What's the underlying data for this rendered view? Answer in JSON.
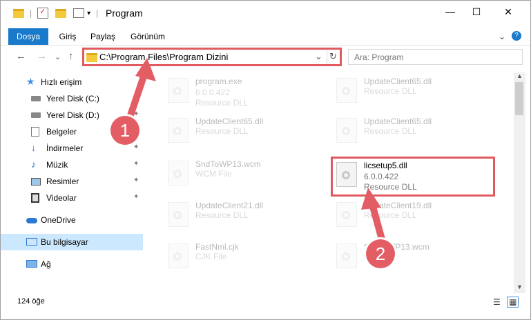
{
  "window": {
    "title": "Program",
    "minimize_glyph": "—",
    "maximize_glyph": "☐",
    "close_glyph": "✕"
  },
  "ribbon": {
    "tabs": [
      "Dosya",
      "Giriş",
      "Paylaş",
      "Görünüm"
    ],
    "expand_glyph": "⌄",
    "help_glyph": "?"
  },
  "nav": {
    "back_glyph": "←",
    "forward_glyph": "→",
    "recent_glyph": "⌄",
    "up_glyph": "↑",
    "address": "C:\\Program Files\\Program Dizini",
    "dropdown_glyph": "⌄",
    "refresh_glyph": "↻",
    "search_placeholder": "Ara: Program",
    "search_glyph": "⌕"
  },
  "sidebar": {
    "quick_access": "Hızlı erişim",
    "items": [
      {
        "label": "Yerel Disk (C:)",
        "icon": "drive-icon"
      },
      {
        "label": "Yerel Disk (D:)",
        "icon": "drive-icon"
      },
      {
        "label": "Belgeler",
        "icon": "documents-icon"
      },
      {
        "label": "İndirmeler",
        "icon": "download-icon"
      },
      {
        "label": "Müzik",
        "icon": "music-icon"
      },
      {
        "label": "Resimler",
        "icon": "pictures-icon"
      },
      {
        "label": "Videolar",
        "icon": "video-icon"
      }
    ],
    "onedrive": "OneDrive",
    "this_pc": "Bu bilgisayar",
    "network": "Ağ",
    "pin_glyph": "📌"
  },
  "files": [
    {
      "name": "program.exe",
      "version": "6.0.0.422",
      "type": "Resource DLL",
      "faded": true
    },
    {
      "name": "UpdateClient65.dll",
      "version": "",
      "type": "Resource DLL",
      "faded": true
    },
    {
      "name": "UpdateClient65.dll",
      "version": "",
      "type": "Resource DLL",
      "faded": true
    },
    {
      "name": "UpdateClient65.dll",
      "version": "",
      "type": "Resource DLL",
      "faded": true
    },
    {
      "name": "SndToWP13.wcm",
      "version": "",
      "type": "WCM File",
      "faded": true
    },
    {
      "name": "licsetup5.dll",
      "version": "6.0.0.422",
      "type": "Resource DLL",
      "faded": false
    },
    {
      "name": "UpdateClient21.dll",
      "version": "",
      "type": "Resource DLL",
      "faded": true
    },
    {
      "name": "UpdateClient19.dll",
      "version": "",
      "type": "Resource DLL",
      "faded": true
    },
    {
      "name": "FastNml.cjk",
      "version": "",
      "type": "CJK File",
      "faded": true
    },
    {
      "name": "SndToWP13.wcm",
      "version": "",
      "type": "",
      "faded": true
    }
  ],
  "status": {
    "count": "124 öğe"
  },
  "annotations": {
    "step1": "1",
    "step2": "2",
    "color": "#e05a5f"
  }
}
